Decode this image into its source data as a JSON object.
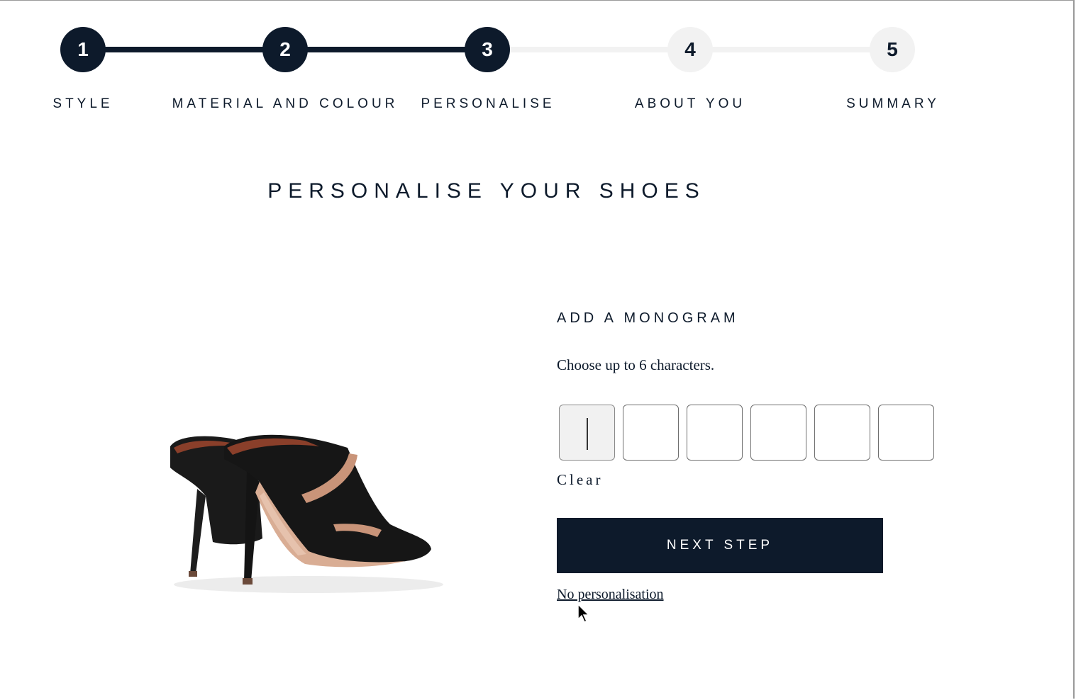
{
  "stepper": {
    "steps": [
      {
        "number": "1",
        "label": "STYLE"
      },
      {
        "number": "2",
        "label": "MATERIAL AND COLOUR"
      },
      {
        "number": "3",
        "label": "PERSONALISE"
      },
      {
        "number": "4",
        "label": "ABOUT YOU"
      },
      {
        "number": "5",
        "label": "SUMMARY"
      }
    ],
    "current_step": 3
  },
  "page": {
    "title": "PERSONALISE YOUR SHOES"
  },
  "monogram": {
    "title": "ADD A MONOGRAM",
    "hint": "Choose up to 6 characters.",
    "characters": [
      "",
      "",
      "",
      "",
      "",
      ""
    ],
    "clear_label": "Clear"
  },
  "actions": {
    "next_label": "NEXT STEP",
    "skip_label": "No personalisation"
  },
  "colors": {
    "navy": "#0d1a2b",
    "inactive": "#f2f2f2"
  },
  "icons": {
    "product": "shoe-image",
    "pointer": "mouse-cursor-icon"
  }
}
